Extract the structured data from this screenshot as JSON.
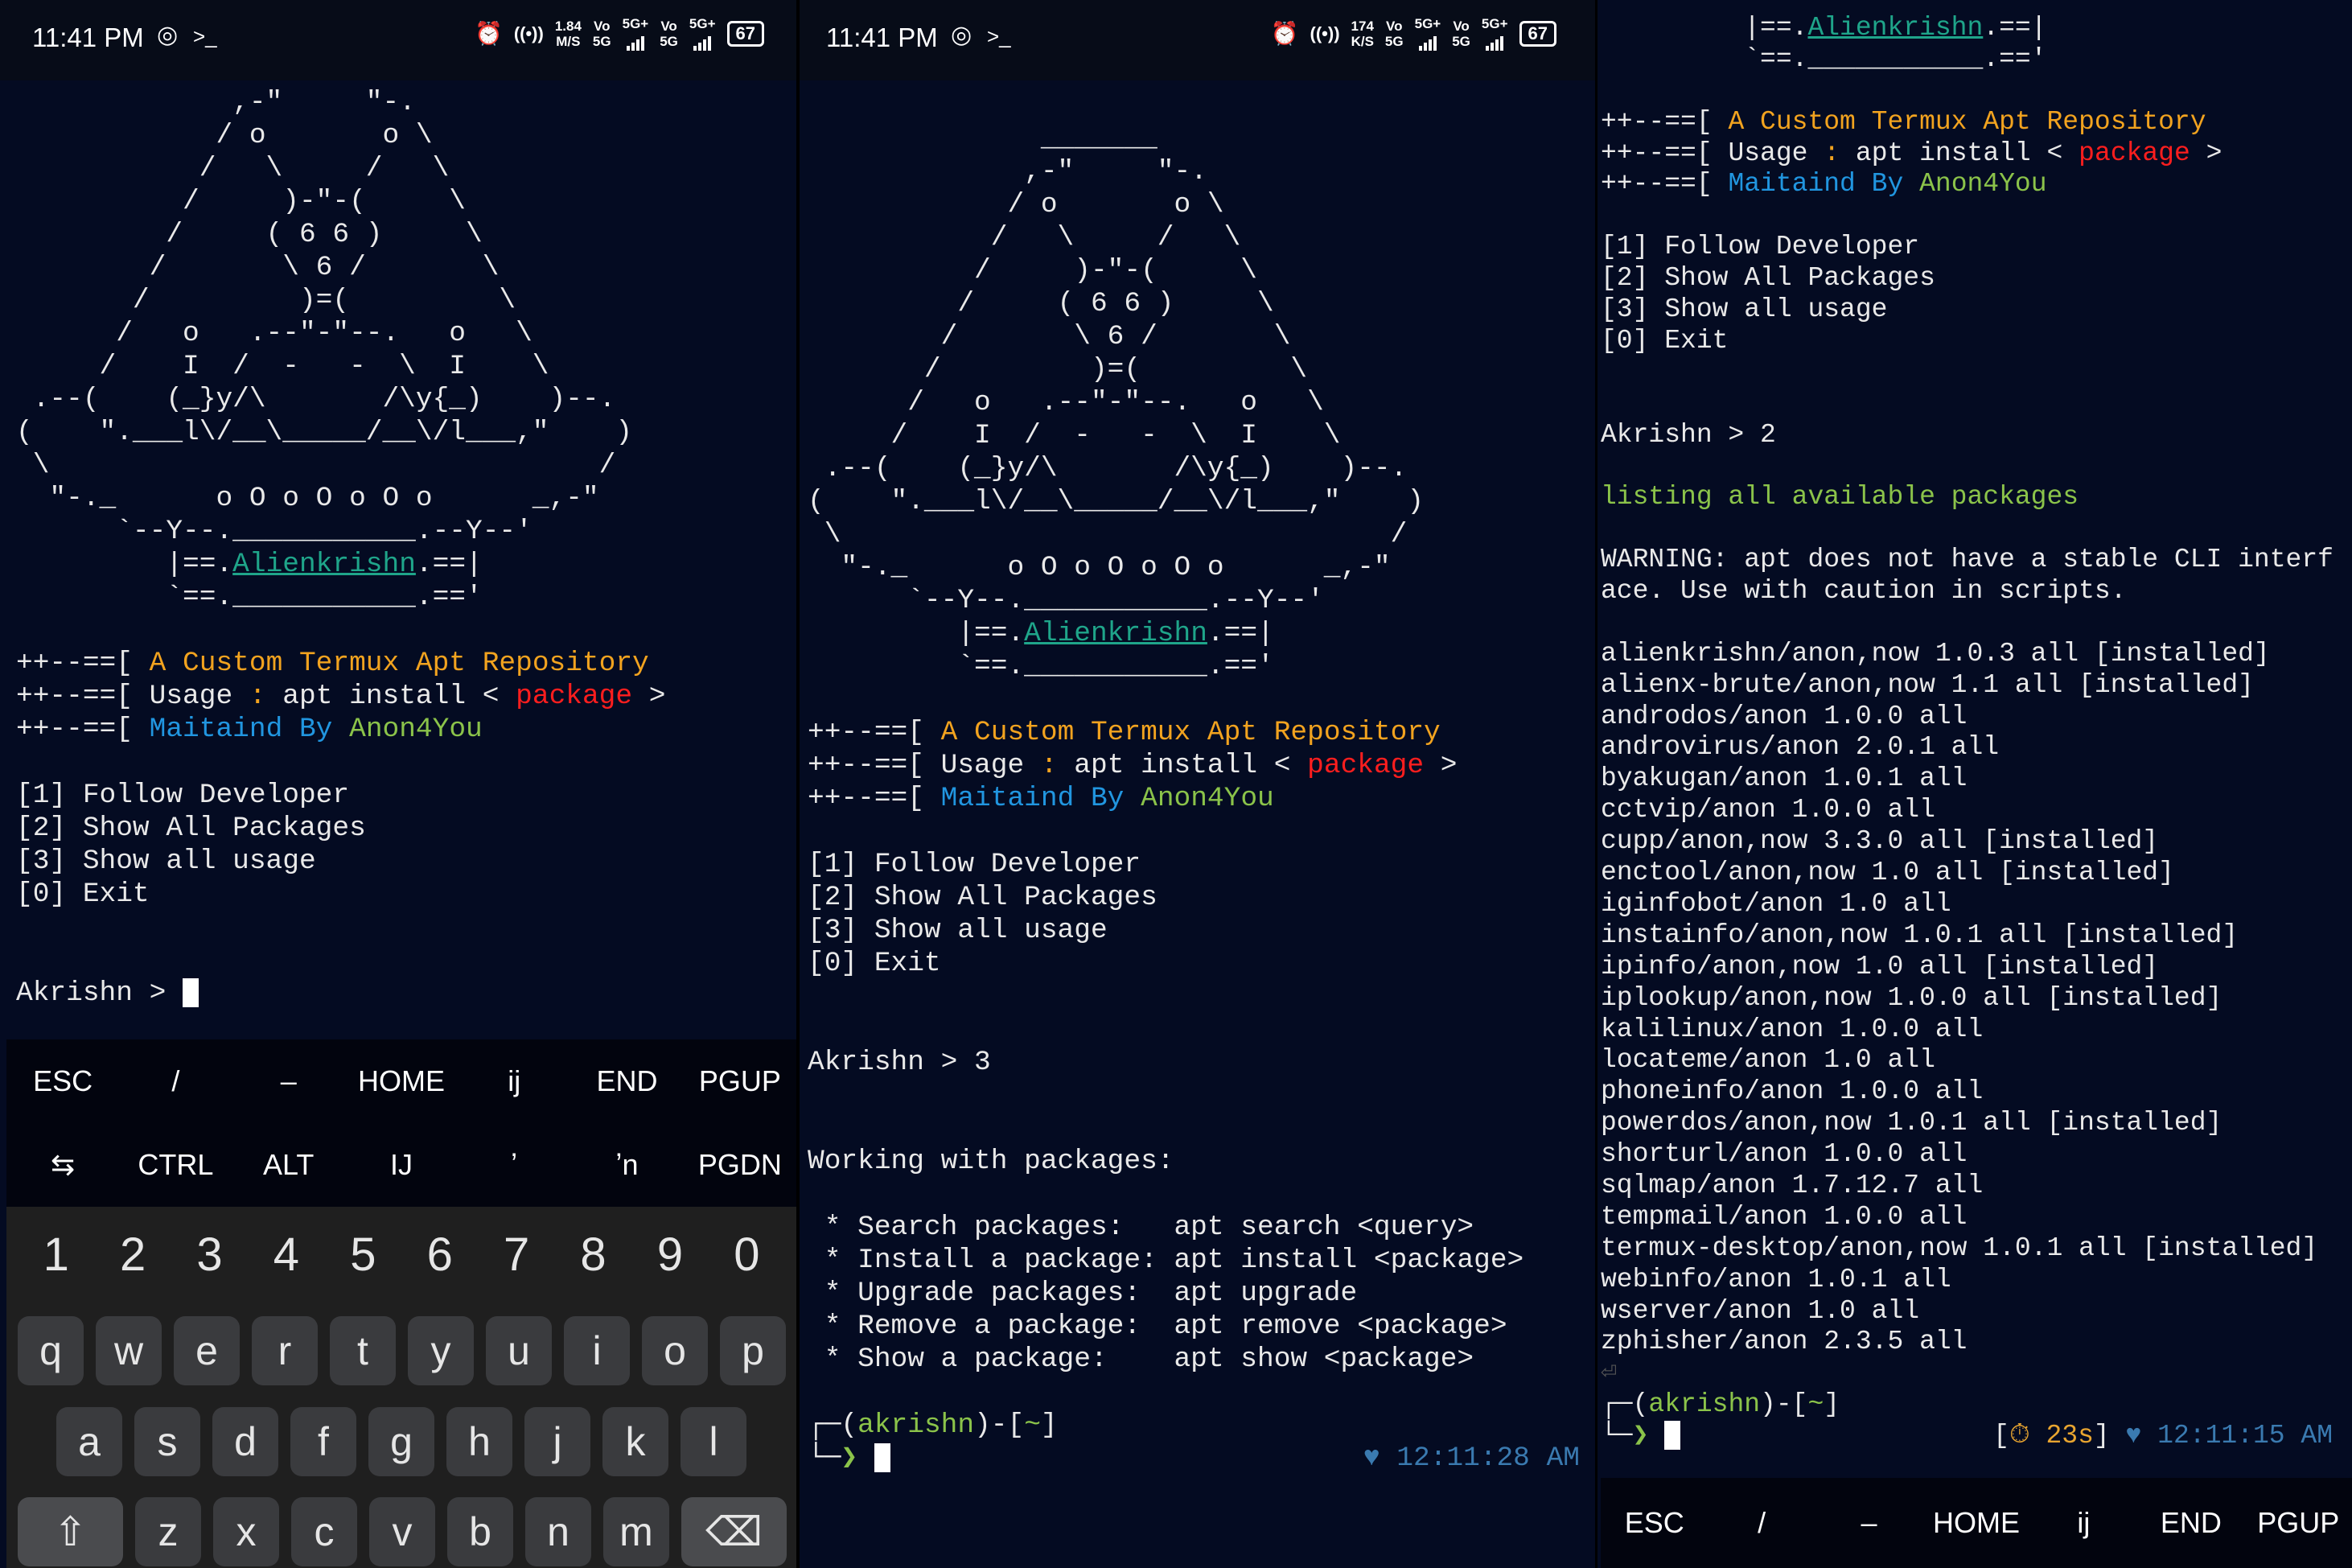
{
  "status_bars": [
    {
      "time": "11:41 PM",
      "speed_value": "1.84",
      "speed_unit": "M/S",
      "vo1_top": "Vo",
      "vo1_bottom": "5G",
      "net1": "5G+",
      "vo2_top": "Vo",
      "vo2_bottom": "5G",
      "net2": "5G+",
      "battery": "67"
    },
    {
      "time": "11:41 PM",
      "speed_value": "174",
      "speed_unit": "K/S",
      "vo1_top": "Vo",
      "vo1_bottom": "5G",
      "net1": "5G+",
      "vo2_top": "Vo",
      "vo2_bottom": "5G",
      "net2": "5G+",
      "battery": "67"
    }
  ],
  "icons": {
    "instagram": "◎",
    "terminal": ">_",
    "alarm": "⏰",
    "hotspot": "((•))",
    "heart": "♥",
    "timer": "⏱",
    "return": "⏎",
    "shift": "⇧",
    "backspace": "⌫",
    "tab": "⇆"
  },
  "art": [
    "              _______",
    "             ,-\"     \"-.",
    "            / o       o \\",
    "           /   \\     /   \\",
    "          /     )-\"-(     \\",
    "         /     ( 6 6 )     \\",
    "        /       \\ 6 /       \\",
    "       /         )=(         \\",
    "      /   o   .--\"-\"--.   o   \\",
    "     /    I  /  -   -  \\  I    \\",
    " .--(    (_}y/\\       /\\y{_)    )--.",
    "(    \".___l\\/__\\_____/__\\/l___,\"    )",
    " \\                                 /",
    "  \"-._      o O o O o O o      _,-\"",
    "      `--Y--.___________.--Y--'"
  ],
  "logo": {
    "pre": "         |==.",
    "link": "Alienkrishn",
    "post": ".==|",
    "bottom": "         `==.___________.=='"
  },
  "banner": {
    "prefix": "++--==[ ",
    "title": "A Custom Termux Apt Repository",
    "usage_label": "Usage",
    "usage_colon": " : ",
    "usage_cmd": "apt install < ",
    "usage_pkg": "package",
    "usage_end": " >",
    "maint_by": "Maitaind By",
    "maint_name": "Anon4You"
  },
  "menu": [
    "[1] Follow Developer",
    "[2] Show All Packages",
    "[3] Show all usage",
    "[0] Exit"
  ],
  "panels": {
    "left": {
      "prompt": "Akrishn > "
    },
    "middle": {
      "prompt": "Akrishn > 3",
      "heading": "Working with packages:",
      "usage": [
        " * Search packages:   apt search <query>",
        " * Install a package: apt install <package>",
        " * Upgrade packages:  apt upgrade",
        " * Remove a package:  apt remove <package>",
        " * Show a package:    apt show <package>"
      ],
      "clock": "12:11:28 AM"
    },
    "right": {
      "prompt": "Akrishn > 2",
      "listing": "listing all available packages",
      "warning": [
        "WARNING: apt does not have a stable CLI interf",
        "ace. Use with caution in scripts."
      ],
      "packages": [
        "alienkrishn/anon,now 1.0.3 all [installed]",
        "alienx-brute/anon,now 1.1 all [installed]",
        "androdos/anon 1.0.0 all",
        "androvirus/anon 2.0.1 all",
        "byakugan/anon 1.0.1 all",
        "cctvip/anon 1.0.0 all",
        "cupp/anon,now 3.3.0 all [installed]",
        "enctool/anon,now 1.0 all [installed]",
        "iginfobot/anon 1.0 all",
        "instainfo/anon,now 1.0.1 all [installed]",
        "ipinfo/anon,now 1.0 all [installed]",
        "iplookup/anon,now 1.0.0 all [installed]",
        "kalilinux/anon 1.0.0 all",
        "locateme/anon 1.0 all",
        "phoneinfo/anon 1.0.0 all",
        "powerdos/anon,now 1.0.1 all [installed]",
        "shorturl/anon 1.0.0 all",
        "sqlmap/anon 1.7.12.7 all",
        "tempmail/anon 1.0.0 all",
        "termux-desktop/anon,now 1.0.1 all [installed]",
        "webinfo/anon 1.0.1 all",
        "wserver/anon 1.0 all",
        "zphisher/anon 2.3.5 all"
      ],
      "timer": "23s",
      "clock": "12:11:15 AM"
    }
  },
  "shell_prompt": {
    "open": "┌─(",
    "user": "akrishn",
    "mid": ")-[",
    "dir": "~",
    "close": "]",
    "arrow_pre": "└─",
    "arrow": "❯"
  },
  "extra_keys": {
    "row1": [
      "ESC",
      "/",
      "–",
      "HOME",
      "ij",
      "END",
      "PGUP"
    ],
    "row2": [
      "⇆",
      "CTRL",
      "ALT",
      "IJ",
      "ʼ",
      "ʼn",
      "PGDN"
    ]
  },
  "keyboard": {
    "numbers": [
      "1",
      "2",
      "3",
      "4",
      "5",
      "6",
      "7",
      "8",
      "9",
      "0"
    ],
    "row1": [
      "q",
      "w",
      "e",
      "r",
      "t",
      "y",
      "u",
      "i",
      "o",
      "p"
    ],
    "row2": [
      "a",
      "s",
      "d",
      "f",
      "g",
      "h",
      "j",
      "k",
      "l"
    ],
    "row3": [
      "z",
      "x",
      "c",
      "v",
      "b",
      "n",
      "m"
    ]
  }
}
